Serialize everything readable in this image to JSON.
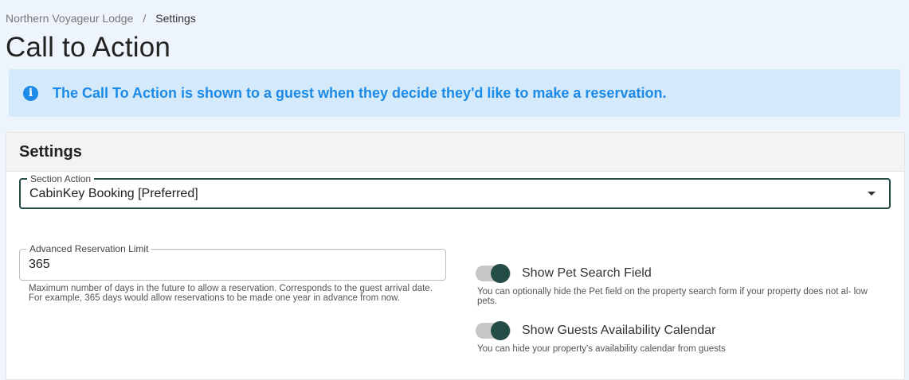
{
  "breadcrumb": {
    "parent": "Northern Voyageur Lodge",
    "separator": "/",
    "current": "Settings"
  },
  "page": {
    "title": "Call to Action"
  },
  "info_banner": {
    "icon": "info-icon",
    "text": "The Call To Action is shown to a guest when they decide they'd like to make a reservation."
  },
  "settings": {
    "title": "Settings",
    "section_action": {
      "label": "Section Action",
      "value": "CabinKey Booking [Preferred]"
    },
    "reservation_limit": {
      "label": "Advanced Reservation Limit",
      "value": "365",
      "help": "Maximum number of days in the future to allow a reservation. Corresponds to the guest arrival date. For example, 365 days would allow reservations to be made one year in advance from now."
    },
    "toggles": [
      {
        "label": "Show Pet Search Field",
        "checked": true,
        "help": "You can optionally hide the Pet field on the property search form if your property does not al- low pets."
      },
      {
        "label": "Show Guests Availability Calendar",
        "checked": true,
        "help": "You can hide your property's availability calendar from guests"
      }
    ]
  },
  "colors": {
    "accent": "#244b45",
    "info": "#1b8ae8",
    "info_bg": "#d4e9fa",
    "page_bg": "#eef4fb"
  }
}
